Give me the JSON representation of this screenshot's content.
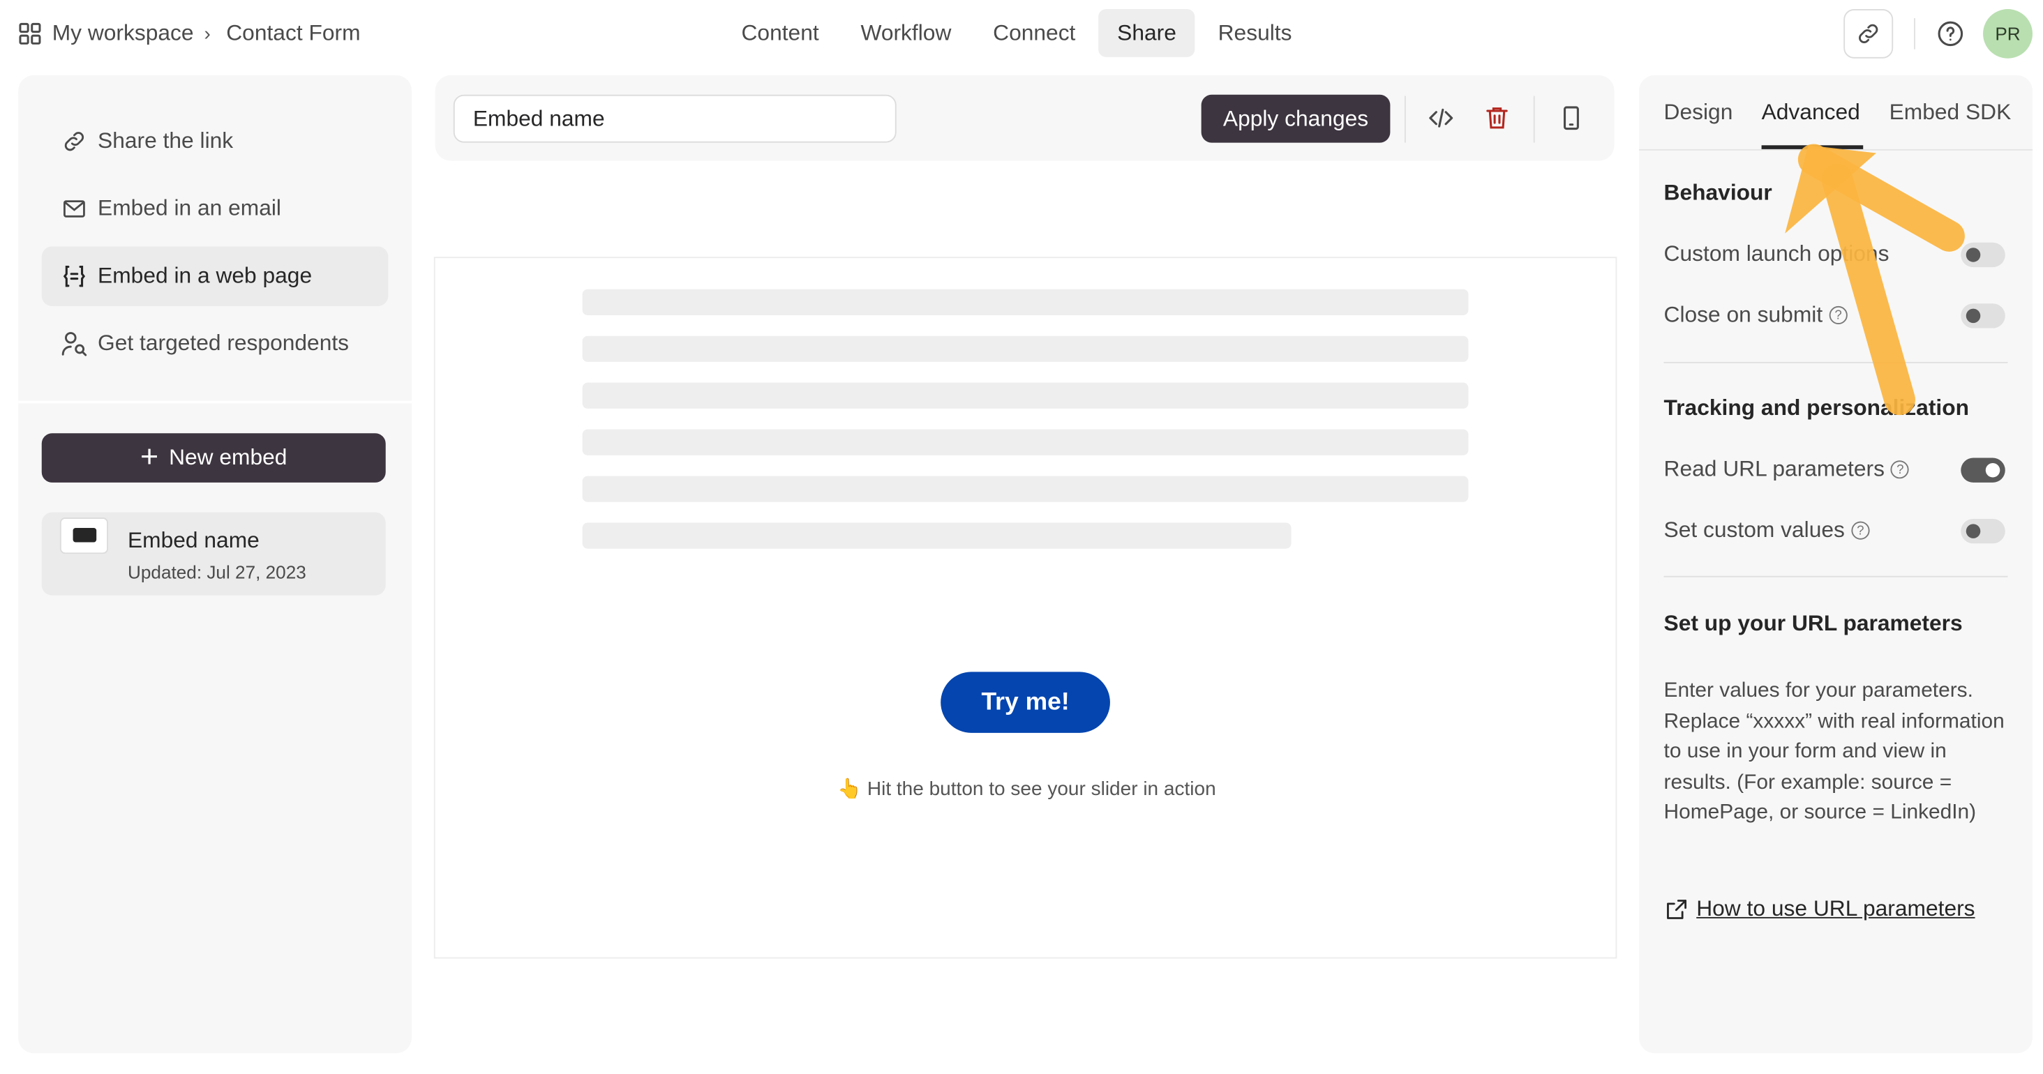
{
  "breadcrumb": {
    "workspace": "My workspace",
    "chevron": "›",
    "form": "Contact Form"
  },
  "top_tabs": [
    {
      "label": "Content",
      "active": false
    },
    {
      "label": "Workflow",
      "active": false
    },
    {
      "label": "Connect",
      "active": false
    },
    {
      "label": "Share",
      "active": true
    },
    {
      "label": "Results",
      "active": false
    }
  ],
  "avatar_initials": "PR",
  "left_menu": [
    {
      "label": "Share the link",
      "icon": "link-icon",
      "active": false
    },
    {
      "label": "Embed in an email",
      "icon": "mail-icon",
      "active": false
    },
    {
      "label": "Embed in a web page",
      "icon": "embed-code-icon",
      "active": true
    },
    {
      "label": "Get targeted respondents",
      "icon": "respondents-icon",
      "active": false
    }
  ],
  "new_embed": {
    "plus": "+",
    "label": "New embed"
  },
  "embed_card": {
    "name": "Embed name",
    "updated": "Updated: Jul 27, 2023"
  },
  "toolbar": {
    "embed_name_value": "Embed name",
    "apply_label": "Apply changes"
  },
  "preview": {
    "button_label": "Try me!",
    "hint": "👆 Hit the button to see your slider in action"
  },
  "right_tabs": [
    {
      "label": "Design",
      "active": false
    },
    {
      "label": "Advanced",
      "active": true
    },
    {
      "label": "Embed SDK",
      "active": false
    }
  ],
  "behaviour": {
    "heading": "Behaviour",
    "custom_launch": {
      "label": "Custom launch options",
      "on": false
    },
    "close_on_submit": {
      "label": "Close on submit",
      "on": false
    }
  },
  "tracking": {
    "heading": "Tracking and personalization",
    "read_url": {
      "label": "Read URL parameters",
      "on": true
    },
    "custom_values": {
      "label": "Set custom values",
      "on": false
    }
  },
  "url_params": {
    "heading": "Set up your URL parameters",
    "description": "Enter values for your parameters. Replace “xxxxx” with real information to use in your form and view in results. (For example: source = HomePage, or source = LinkedIn)",
    "link_label": "How to use URL parameters"
  },
  "colors": {
    "dark_button": "#3d3540",
    "try_button": "#0445af",
    "annotation_arrow": "#fbb540",
    "avatar_bg": "#b9dfb0",
    "delete_icon": "#b3261e"
  }
}
